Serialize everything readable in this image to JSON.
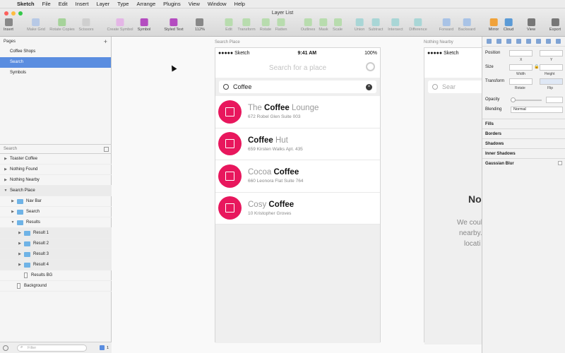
{
  "menubar": {
    "items": [
      "Sketch",
      "File",
      "Edit",
      "Insert",
      "Layer",
      "Type",
      "Arrange",
      "Plugins",
      "View",
      "Window",
      "Help"
    ]
  },
  "window": {
    "title": "Layer List"
  },
  "toolbar": {
    "tools": [
      {
        "label": "Insert",
        "color": "#888888",
        "enabled": true
      },
      {
        "label": "Make Grid",
        "color": "#b7c9e6",
        "enabled": false
      },
      {
        "label": "Rotate Copies",
        "color": "#a6d39a",
        "enabled": false
      },
      {
        "label": "Scissors",
        "color": "#cfcfcf",
        "enabled": false
      },
      {
        "label": "Create Symbol",
        "color": "#e4b6e6",
        "enabled": false
      },
      {
        "label": "Symbol",
        "color": "#b44cc0",
        "enabled": true
      },
      {
        "label": "Styled Text",
        "color": "#b44cc0",
        "enabled": true
      },
      {
        "label": "112%",
        "color": "#888888",
        "enabled": true
      },
      {
        "label": "Edit",
        "color": "#b8dcae",
        "enabled": false
      },
      {
        "label": "Transform",
        "color": "#b8dcae",
        "enabled": false
      },
      {
        "label": "Rotate",
        "color": "#b8dcae",
        "enabled": false
      },
      {
        "label": "Flatten",
        "color": "#b8dcae",
        "enabled": false
      },
      {
        "label": "Outlines",
        "color": "#b8dcae",
        "enabled": false
      },
      {
        "label": "Mask",
        "color": "#b8dcae",
        "enabled": false
      },
      {
        "label": "Scale",
        "color": "#b8dcae",
        "enabled": false
      },
      {
        "label": "Union",
        "color": "#a9d6d6",
        "enabled": false
      },
      {
        "label": "Subtract",
        "color": "#a9d6d6",
        "enabled": false
      },
      {
        "label": "Intersect",
        "color": "#a9d6d6",
        "enabled": false
      },
      {
        "label": "Difference",
        "color": "#a9d6d6",
        "enabled": false
      },
      {
        "label": "Forward",
        "color": "#a9c3e6",
        "enabled": false
      },
      {
        "label": "Backward",
        "color": "#a9c3e6",
        "enabled": false
      },
      {
        "label": "Mirror",
        "color": "#f0a23a",
        "enabled": true
      },
      {
        "label": "Cloud",
        "color": "#5a9ad6",
        "enabled": true
      },
      {
        "label": "View",
        "color": "#777777",
        "enabled": true
      },
      {
        "label": "Export",
        "color": "#777777",
        "enabled": true
      }
    ]
  },
  "leftpanel": {
    "pages_label": "Pages",
    "add_symbol": "+",
    "pages": [
      {
        "label": "Coffee Shops",
        "selected": false
      },
      {
        "label": "Search",
        "selected": true
      },
      {
        "label": "Symbols",
        "selected": false
      }
    ],
    "search_placeholder": "Search",
    "layers": [
      {
        "label": "Toaster Coffee",
        "depth": 0,
        "kind": "artboard",
        "open": false
      },
      {
        "label": "Nothing Found",
        "depth": 0,
        "kind": "artboard",
        "open": false
      },
      {
        "label": "Nothing Nearby",
        "depth": 0,
        "kind": "artboard",
        "open": false
      },
      {
        "label": "Search Place",
        "depth": 0,
        "kind": "artboard",
        "open": true
      },
      {
        "label": "Nav Bar",
        "depth": 1,
        "kind": "folder",
        "open": false
      },
      {
        "label": "Search",
        "depth": 1,
        "kind": "folder",
        "open": false
      },
      {
        "label": "Results",
        "depth": 1,
        "kind": "folder",
        "open": true
      },
      {
        "label": "Result 1",
        "depth": 2,
        "kind": "folder",
        "open": false
      },
      {
        "label": "Result 2",
        "depth": 2,
        "kind": "folder",
        "open": false
      },
      {
        "label": "Result 3",
        "depth": 2,
        "kind": "folder",
        "open": false
      },
      {
        "label": "Result 4",
        "depth": 2,
        "kind": "folder",
        "open": false
      },
      {
        "label": "Results BG",
        "depth": 2,
        "kind": "rect",
        "open": false
      },
      {
        "label": "Background",
        "depth": 1,
        "kind": "rect",
        "open": false
      }
    ],
    "filter_placeholder": "Filter",
    "filter_count": "1"
  },
  "canvas": {
    "artboard1_label": "Search Place",
    "artboard2_label": "Nothing Nearby",
    "phone": {
      "carrier": "●●●●● Sketch",
      "time": "9:41 AM",
      "battery": "100%",
      "nav_title": "Search for a place",
      "search_value": "Coffee",
      "results": [
        {
          "pre": "The ",
          "match": "Coffee",
          "post": " Lounge",
          "address": "672 Robel Glen Suite 003"
        },
        {
          "pre": "",
          "match": "Coffee",
          "post": " Hut",
          "address": "659 Kirsten Walks Apt. 435"
        },
        {
          "pre": "Cocoa ",
          "match": "Coffee",
          "post": "",
          "address": "660 Leonora Flat Suite 764"
        },
        {
          "pre": "Cosy ",
          "match": "Coffee",
          "post": "",
          "address": "10 Kristopher Groves"
        }
      ]
    },
    "phone2": {
      "carrier": "●●●●● Sketch",
      "nav_title": "Se",
      "search_value": "Sear",
      "heading": "No",
      "body": [
        "We coul",
        "nearby. P",
        "locati"
      ]
    }
  },
  "inspector": {
    "position_label": "Position",
    "x_label": "X",
    "y_label": "Y",
    "size_label": "Size",
    "width_label": "Width",
    "height_label": "Height",
    "transform_label": "Transform",
    "rotate_label": "Rotate",
    "flip_label": "Flip",
    "opacity_label": "Opacity",
    "blending_label": "Blending",
    "blending_value": "Normal",
    "sections": [
      "Fills",
      "Borders",
      "Shadows",
      "Inner Shadows",
      "Gaussian Blur"
    ],
    "accent_color": "#e8175d"
  }
}
